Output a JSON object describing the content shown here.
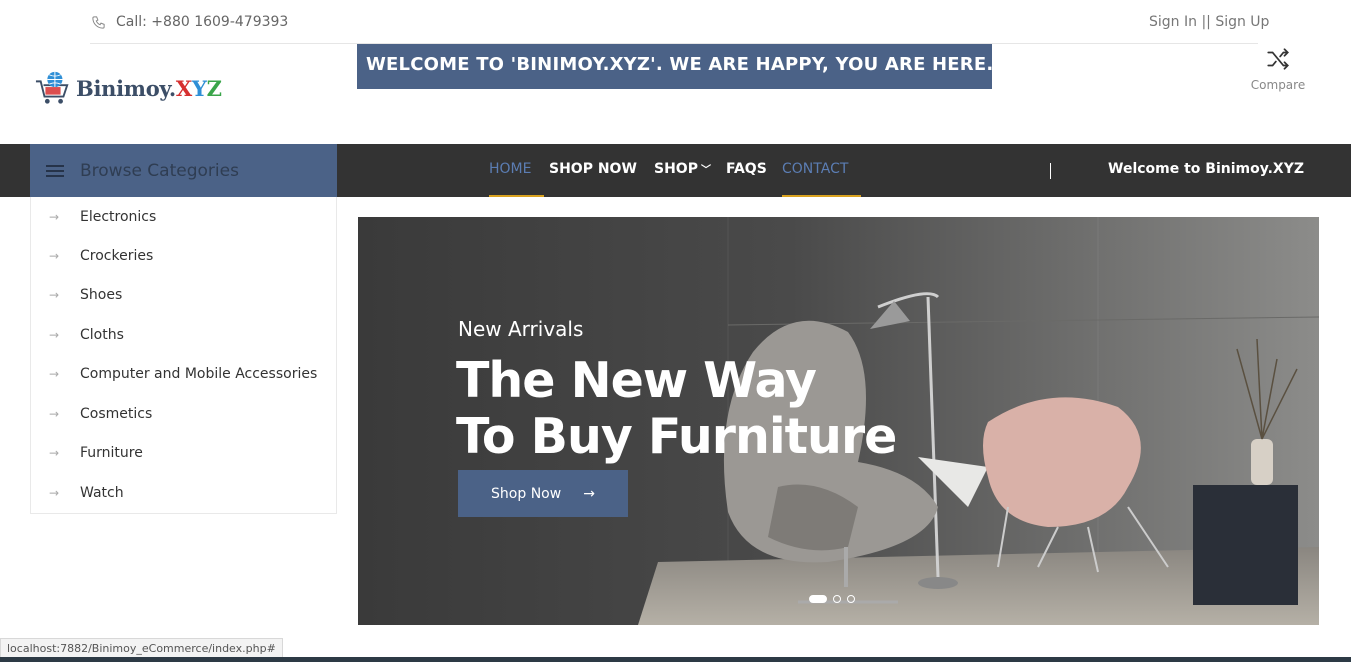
{
  "topbar": {
    "phone": "Call: +880 1609-479393",
    "auth": "Sign In || Sign Up"
  },
  "header": {
    "logo_main": "Binimoy.",
    "logo_x": "X",
    "logo_y": "Y",
    "logo_z": "Z",
    "marquee": "WELCOME TO 'BINIMOY.XYZ'. WE ARE HAPPY, YOU ARE HERE. ENJ",
    "compare_label": "Compare"
  },
  "nav": {
    "browse": "Browse Categories",
    "items": [
      "HOME",
      "SHOP NOW",
      "SHOP",
      "FAQS",
      "CONTACT"
    ],
    "welcome": "Welcome to Binimoy.XYZ"
  },
  "categories": [
    "Electronics",
    "Crockeries",
    "Shoes",
    "Cloths",
    "Computer and Mobile Accessories",
    "Cosmetics",
    "Furniture",
    "Watch"
  ],
  "hero": {
    "eyebrow": "New Arrivals",
    "title_line1": "The New Way",
    "title_line2": "To Buy Furniture",
    "button": "Shop Now",
    "slide_count": 3,
    "active_slide": 1
  },
  "status_url": "localhost:7882/Binimoy_eCommerce/index.php#",
  "colors": {
    "brand_blue": "#4b6287",
    "nav_bg": "#333333",
    "accent_underline": "#d9a21f"
  }
}
